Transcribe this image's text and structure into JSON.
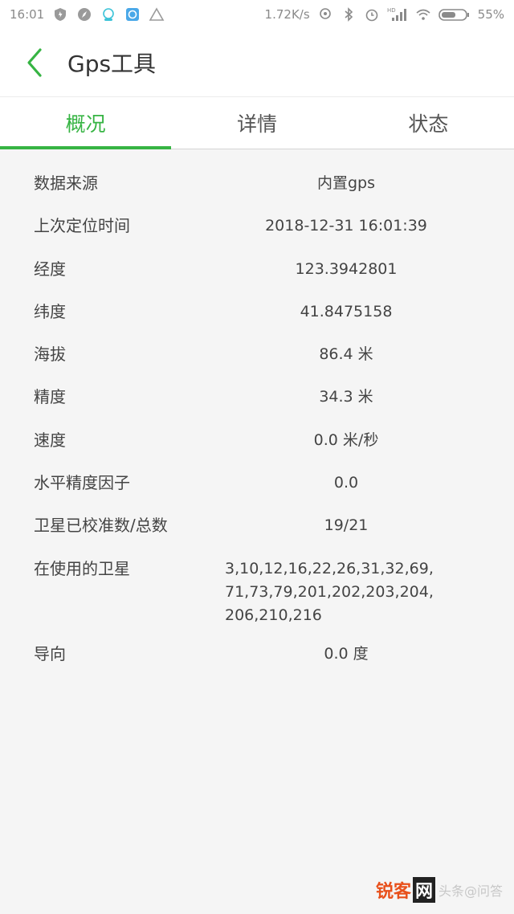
{
  "status_bar": {
    "time": "16:01",
    "net_speed": "1.72K/s",
    "battery": "55%",
    "hd_label": "HD"
  },
  "app_bar": {
    "title": "Gps工具"
  },
  "tabs": [
    {
      "label": "概况",
      "active": true
    },
    {
      "label": "详情",
      "active": false
    },
    {
      "label": "状态",
      "active": false
    }
  ],
  "rows": [
    {
      "label": "数据来源",
      "value": "内置gps"
    },
    {
      "label": "上次定位时间",
      "value": "2018-12-31 16:01:39"
    },
    {
      "label": "经度",
      "value": "123.3942801"
    },
    {
      "label": "纬度",
      "value": "41.8475158"
    },
    {
      "label": "海拔",
      "value": "86.4 米"
    },
    {
      "label": "精度",
      "value": "34.3 米"
    },
    {
      "label": "速度",
      "value": "0.0 米/秒"
    },
    {
      "label": "水平精度因子",
      "value": "0.0"
    },
    {
      "label": "卫星已校准数/总数",
      "value": "19/21"
    },
    {
      "label": "在使用的卫星",
      "value": "3,10,12,16,22,26,31,32,69,71,73,79,201,202,203,204,206,210,216"
    },
    {
      "label": "导向",
      "value": "0.0 度"
    }
  ],
  "watermark": {
    "part1": "锐客",
    "part2": "网",
    "part3": "头条@问答"
  },
  "colors": {
    "accent": "#36b443",
    "background": "#f5f5f5"
  }
}
